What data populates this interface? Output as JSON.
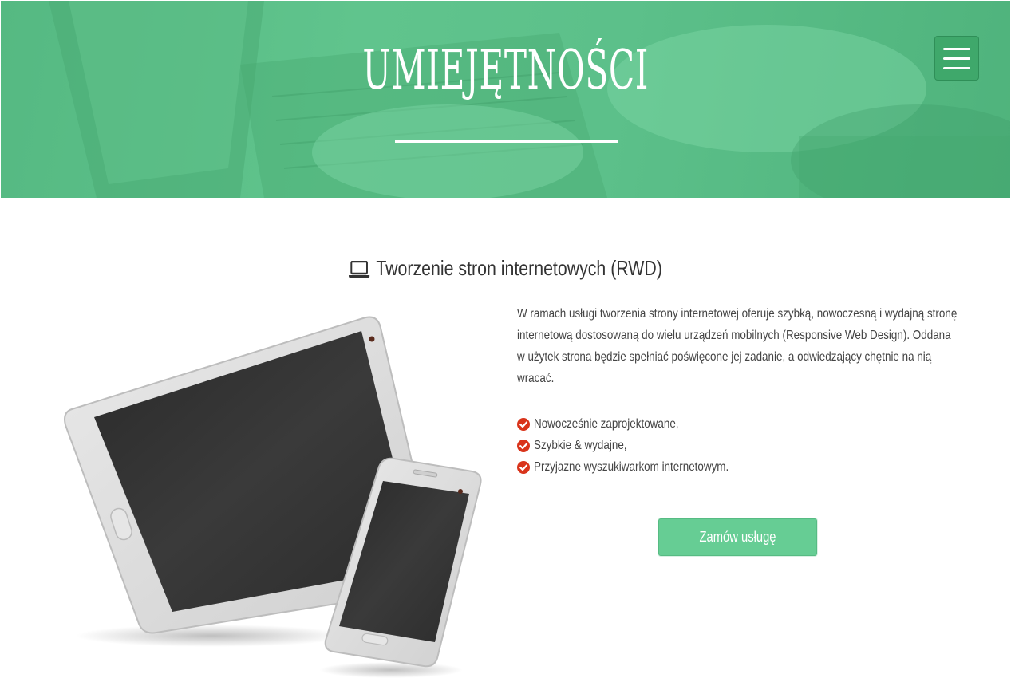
{
  "hero": {
    "title": "UMIEJĘTNOŚCI",
    "menu_icon": "hamburger-icon"
  },
  "section": {
    "title": "Tworzenie stron internetowych (RWD)",
    "title_icon": "laptop-icon",
    "description": "W ramach usługi tworzenia strony internetowej oferuje szybką, nowoczesną i wydajną stronę internetową dostosowaną do wielu urządzeń mobilnych (Responsive Web Design). Oddana w użytek strona będzie spełniać poświęcone jej zadanie, a odwiedzający chętnie na nią wracać.",
    "features": [
      "Nowocześnie zaprojektowane,",
      "Szybkie & wydajne,",
      "Przyjazne wyszukiwarkom internetowym."
    ],
    "feature_icon": "check-circle-icon",
    "cta_label": "Zamów usługę"
  },
  "colors": {
    "hero_green": "#5cc08a",
    "button_green": "#66cd94",
    "check_red": "#d9341b"
  }
}
